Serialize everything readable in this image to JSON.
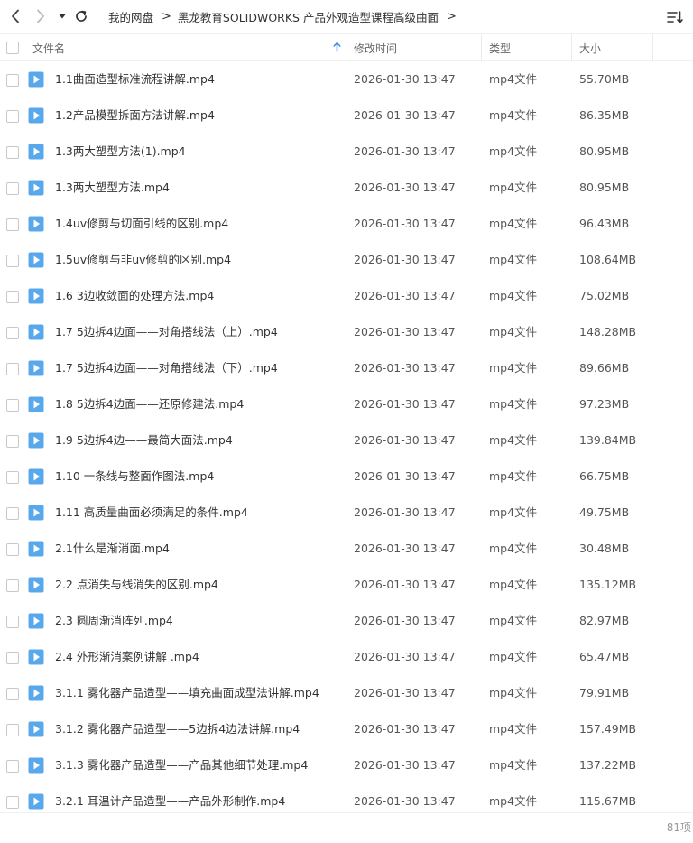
{
  "breadcrumb": {
    "items": [
      "我的网盘",
      "黑龙教育SOLIDWORKS 产品外观造型课程高级曲面"
    ],
    "separator": ">"
  },
  "columns": {
    "name": "文件名",
    "modified": "修改时间",
    "type": "类型",
    "size": "大小"
  },
  "icons": {
    "back": "chevron-left-icon",
    "forward": "chevron-right-icon",
    "history": "caret-down-icon",
    "refresh": "refresh-icon",
    "sort": "sort-list-icon",
    "file": "video-file-icon"
  },
  "colors": {
    "file_icon": "#5aa8ec",
    "sort_arrow": "#3b8cf0"
  },
  "files": [
    {
      "name": "1.1曲面造型标准流程讲解.mp4",
      "modified": "2026-01-30 13:47",
      "type": "mp4文件",
      "size": "55.70MB"
    },
    {
      "name": "1.2产品模型拆面方法讲解.mp4",
      "modified": "2026-01-30 13:47",
      "type": "mp4文件",
      "size": "86.35MB"
    },
    {
      "name": "1.3两大塑型方法(1).mp4",
      "modified": "2026-01-30 13:47",
      "type": "mp4文件",
      "size": "80.95MB"
    },
    {
      "name": "1.3两大塑型方法.mp4",
      "modified": "2026-01-30 13:47",
      "type": "mp4文件",
      "size": "80.95MB"
    },
    {
      "name": "1.4uv修剪与切面引线的区别.mp4",
      "modified": "2026-01-30 13:47",
      "type": "mp4文件",
      "size": "96.43MB"
    },
    {
      "name": "1.5uv修剪与非uv修剪的区别.mp4",
      "modified": "2026-01-30 13:47",
      "type": "mp4文件",
      "size": "108.64MB"
    },
    {
      "name": "1.6 3边收敛面的处理方法.mp4",
      "modified": "2026-01-30 13:47",
      "type": "mp4文件",
      "size": "75.02MB"
    },
    {
      "name": "1.7 5边拆4边面——对角搭线法（上）.mp4",
      "modified": "2026-01-30 13:47",
      "type": "mp4文件",
      "size": "148.28MB"
    },
    {
      "name": "1.7 5边拆4边面——对角搭线法（下）.mp4",
      "modified": "2026-01-30 13:47",
      "type": "mp4文件",
      "size": "89.66MB"
    },
    {
      "name": "1.8 5边拆4边面——还原修建法.mp4",
      "modified": "2026-01-30 13:47",
      "type": "mp4文件",
      "size": "97.23MB"
    },
    {
      "name": "1.9 5边拆4边——最简大面法.mp4",
      "modified": "2026-01-30 13:47",
      "type": "mp4文件",
      "size": "139.84MB"
    },
    {
      "name": "1.10 一条线与整面作图法.mp4",
      "modified": "2026-01-30 13:47",
      "type": "mp4文件",
      "size": "66.75MB"
    },
    {
      "name": "1.11 高质量曲面必须满足的条件.mp4",
      "modified": "2026-01-30 13:47",
      "type": "mp4文件",
      "size": "49.75MB"
    },
    {
      "name": "2.1什么是渐消面.mp4",
      "modified": "2026-01-30 13:47",
      "type": "mp4文件",
      "size": "30.48MB"
    },
    {
      "name": "2.2 点消失与线消失的区别.mp4",
      "modified": "2026-01-30 13:47",
      "type": "mp4文件",
      "size": "135.12MB"
    },
    {
      "name": "2.3 圆周渐消阵列.mp4",
      "modified": "2026-01-30 13:47",
      "type": "mp4文件",
      "size": "82.97MB"
    },
    {
      "name": "2.4 外形渐消案例讲解 .mp4",
      "modified": "2026-01-30 13:47",
      "type": "mp4文件",
      "size": "65.47MB"
    },
    {
      "name": "3.1.1 雾化器产品造型——填充曲面成型法讲解.mp4",
      "modified": "2026-01-30 13:47",
      "type": "mp4文件",
      "size": "79.91MB"
    },
    {
      "name": "3.1.2 雾化器产品造型——5边拆4边法讲解.mp4",
      "modified": "2026-01-30 13:47",
      "type": "mp4文件",
      "size": "157.49MB"
    },
    {
      "name": "3.1.3 雾化器产品造型——产品其他细节处理.mp4",
      "modified": "2026-01-30 13:47",
      "type": "mp4文件",
      "size": "137.22MB"
    },
    {
      "name": "3.2.1 耳温计产品造型——产品外形制作.mp4",
      "modified": "2026-01-30 13:47",
      "type": "mp4文件",
      "size": "115.67MB"
    }
  ],
  "footer": {
    "item_count": "81项"
  }
}
